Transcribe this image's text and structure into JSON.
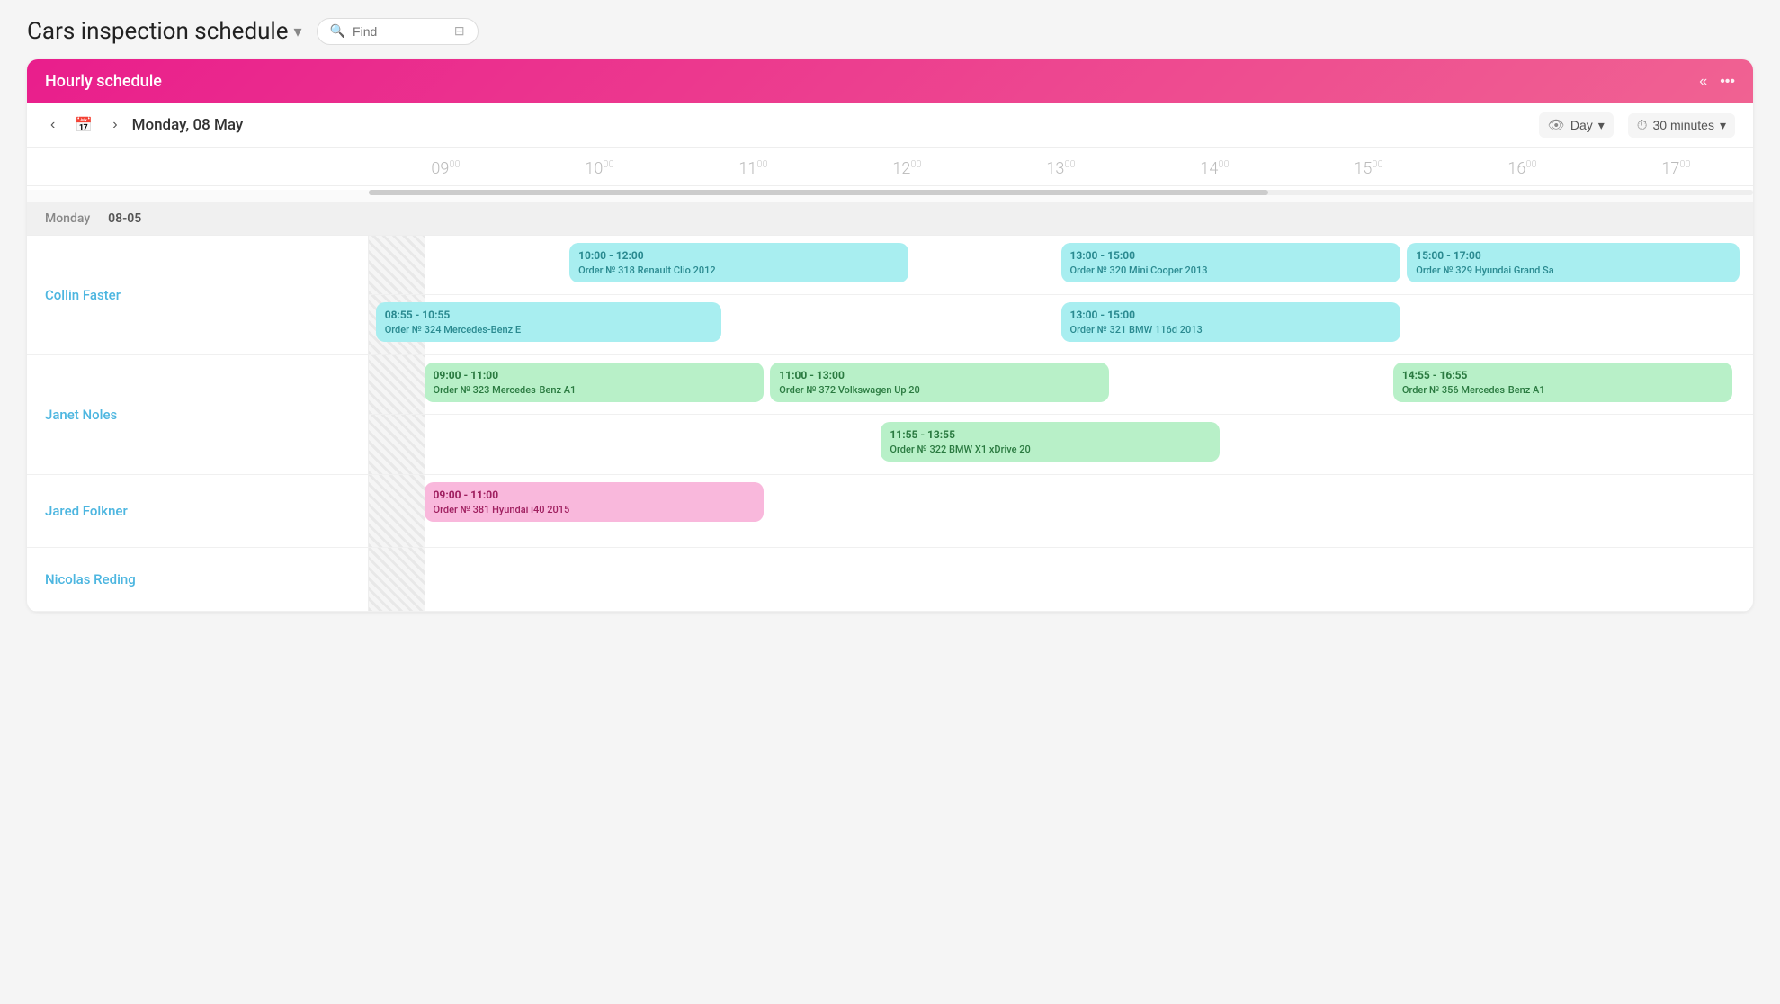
{
  "page": {
    "title": "Cars inspection schedule",
    "title_chevron": "▾",
    "search_placeholder": "Find"
  },
  "schedule": {
    "header_title": "Hourly schedule",
    "nav_date": "Monday, 08 May",
    "view_label": "Day",
    "interval_label": "30 minutes",
    "day_label": "Monday",
    "date_label": "08-05"
  },
  "time_slots": [
    "09",
    "10",
    "11",
    "12",
    "13",
    "14",
    "15",
    "16",
    "17"
  ],
  "people": [
    {
      "name": "Collin Faster",
      "events_row1": [
        {
          "id": "e1",
          "time": "10:00 - 12:00",
          "order": "Order № 318 Renault Clio 2012",
          "color": "cyan",
          "left": "14.5%",
          "width": "24.5%"
        },
        {
          "id": "e2",
          "time": "13:00 - 15:00",
          "order": "Order № 320 Mini Cooper 2013",
          "color": "cyan",
          "left": "49.5%",
          "width": "24.5%"
        },
        {
          "id": "e3",
          "time": "15:00 - 17:00",
          "order": "Order № 329 Hyundai Grand Sa",
          "color": "cyan",
          "left": "74.5%",
          "width": "24.5%"
        }
      ],
      "events_row2": [
        {
          "id": "e4",
          "time": "08:55 - 10:55",
          "order": "Order № 324 Mercedes-Benz E",
          "color": "cyan",
          "left": "1%",
          "width": "24%"
        },
        {
          "id": "e5",
          "time": "13:00 - 15:00",
          "order": "Order № 321 BMW 116d 2013",
          "color": "cyan",
          "left": "49.5%",
          "width": "24.5%"
        }
      ]
    }
  ],
  "janet": {
    "name": "Janet Noles",
    "events_row1": [
      {
        "id": "j1",
        "time": "09:00 - 11:00",
        "order": "Order № 323 Mercedes-Benz A1",
        "color": "green",
        "left": "4%",
        "width": "24.5%"
      },
      {
        "id": "j2",
        "time": "11:00 - 13:00",
        "order": "Order № 372 Volkswagen Up 20",
        "color": "green",
        "left": "29%",
        "width": "24.5%"
      },
      {
        "id": "j3",
        "time": "14:55 - 16:55",
        "order": "Order № 356 Mercedes-Benz A1",
        "color": "green",
        "left": "74%",
        "width": "24.5%"
      }
    ],
    "events_row2": [
      {
        "id": "j4",
        "time": "11:55 - 13:55",
        "order": "Order № 322 BMW X1 xDrive 20",
        "color": "green",
        "left": "36.5%",
        "width": "24.5%"
      }
    ]
  },
  "jared": {
    "name": "Jared Folkner",
    "events": [
      {
        "id": "jf1",
        "time": "09:00 - 11:00",
        "order": "Order № 381 Hyundai i40 2015",
        "color": "pink",
        "left": "4%",
        "width": "24.5%"
      }
    ]
  },
  "nicolas": {
    "name": "Nicolas Reding",
    "events": []
  }
}
